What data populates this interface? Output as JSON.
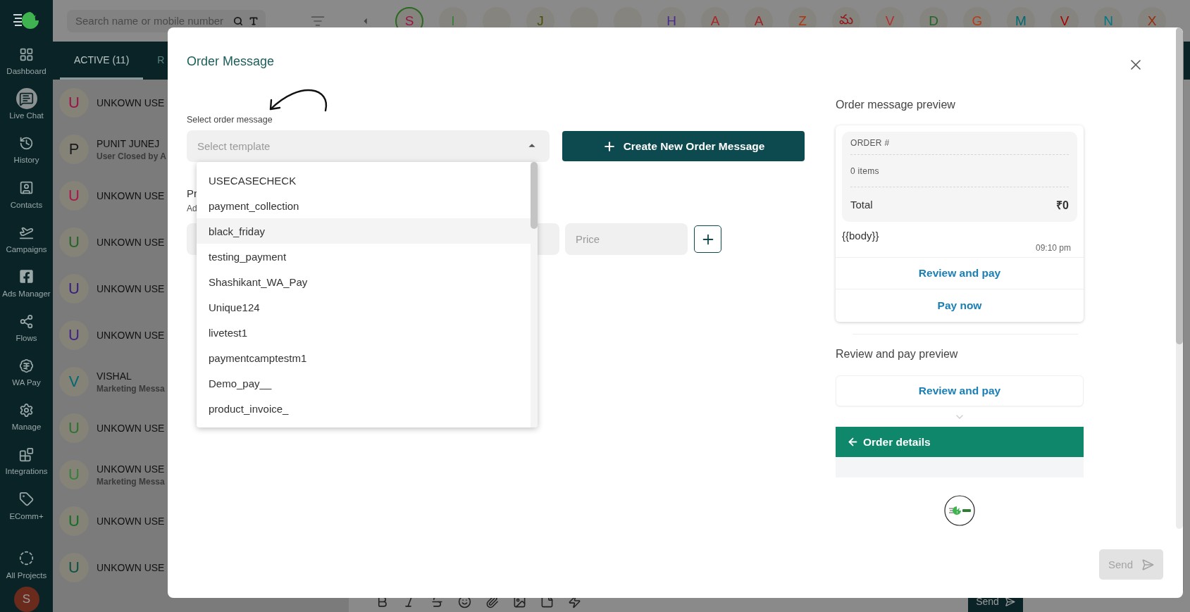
{
  "sidebar": {
    "items": [
      {
        "label": "Dashboard",
        "selected": false
      },
      {
        "label": "Live Chat",
        "selected": true
      },
      {
        "label": "History",
        "selected": false
      },
      {
        "label": "Contacts",
        "selected": false
      },
      {
        "label": "Campaigns",
        "selected": false
      },
      {
        "label": "Ads Manager",
        "selected": false
      },
      {
        "label": "Flows",
        "selected": false
      },
      {
        "label": "WA Pay",
        "selected": false
      },
      {
        "label": "Manage",
        "selected": false
      },
      {
        "label": "Integrations",
        "selected": false
      },
      {
        "label": "EComm+",
        "selected": false
      },
      {
        "label": "All Projects",
        "selected": false
      }
    ],
    "avatar": "S"
  },
  "topbar": {
    "search": {
      "placeholder": "Search name or mobile number"
    },
    "contacts": [
      {
        "kind": "letter",
        "letter": "S",
        "color": "#9b1349",
        "selected": true
      },
      {
        "kind": "letter",
        "letter": "I",
        "color": "#368039",
        "selected": false
      },
      {
        "kind": "blank",
        "selected": false
      },
      {
        "kind": "letter",
        "letter": "J",
        "color": "#4f4f0c",
        "selected": false
      },
      {
        "kind": "blank",
        "selected": false
      },
      {
        "kind": "blank",
        "selected": false
      },
      {
        "kind": "letter",
        "letter": "H",
        "color": "#4b2a8e",
        "selected": false
      },
      {
        "kind": "letter",
        "letter": "A",
        "color": "#a92626",
        "selected": false
      },
      {
        "kind": "letter",
        "letter": "A",
        "color": "#9e2020",
        "selected": false
      },
      {
        "kind": "letter",
        "letter": "Z",
        "color": "#ad3611",
        "selected": false
      },
      {
        "kind": "letter",
        "letter": "మ",
        "color": "#921616",
        "selected": false
      },
      {
        "kind": "letter",
        "letter": "V",
        "color": "#b72e2a",
        "selected": false
      },
      {
        "kind": "letter",
        "letter": "D",
        "color": "#256428",
        "selected": false
      },
      {
        "kind": "letter",
        "letter": "G",
        "color": "#b83b14",
        "selected": false
      },
      {
        "kind": "letter",
        "letter": "M",
        "color": "#006972",
        "selected": false
      },
      {
        "kind": "letter",
        "letter": "V",
        "color": "#aa0000",
        "selected": false
      },
      {
        "kind": "letter",
        "letter": "N",
        "color": "#007986",
        "selected": false
      },
      {
        "kind": "letter",
        "letter": "X",
        "color": "#992b0a",
        "selected": false
      }
    ]
  },
  "chat_list": {
    "tabs": [
      {
        "label": "ACTIVE (11)",
        "selected": true
      },
      {
        "label": "R",
        "selected": false
      }
    ],
    "chats": [
      {
        "initial": "U",
        "color": "#9b1349",
        "name": "UNKOWN USE"
      },
      {
        "initial": "P",
        "color": "#1a1a1a",
        "name": "PUNIT JUNEJ",
        "subtitle": "User Closed by A"
      },
      {
        "initial": "U",
        "color": "#ad164d",
        "name": "UNKOWN USE"
      },
      {
        "initial": "U",
        "color": "#256428",
        "name": "UNKOWN USE"
      },
      {
        "initial": "U",
        "color": "#371f80",
        "name": "UNKOWN USE"
      },
      {
        "initial": "U",
        "color": "#412486",
        "name": "UNKOWN USE"
      },
      {
        "initial": "V",
        "color": "#006972",
        "name": "VISHAL",
        "subtitle": "Marketing Messa"
      },
      {
        "initial": "U",
        "color": "#2d7230",
        "name": "UNKOWN USE"
      },
      {
        "initial": "U",
        "color": "#368039",
        "name": "UNKOWN USE",
        "subtitle": "Marketing Messa"
      },
      {
        "initial": "U",
        "color": "#166e25",
        "name": "UNKOWN USE"
      },
      {
        "initial": "U",
        "color": "#0f5049",
        "name": "UNKOWN USE"
      }
    ]
  },
  "composer": {
    "send_label": "Send"
  },
  "modal": {
    "title": "Order Message",
    "select": {
      "label": "Select order message",
      "placeholder": "Select template",
      "expanded": true
    },
    "options": [
      {
        "label": "USECASECHECK",
        "highlighted": false
      },
      {
        "label": "payment_collection",
        "highlighted": false
      },
      {
        "label": "black_friday",
        "highlighted": true
      },
      {
        "label": "testing_payment",
        "highlighted": false
      },
      {
        "label": "Shashikant_WA_Pay",
        "highlighted": false
      },
      {
        "label": "Unique124",
        "highlighted": false
      },
      {
        "label": "livetest1",
        "highlighted": false
      },
      {
        "label": "paymentcamptestm1",
        "highlighted": false
      },
      {
        "label": "Demo_pay__",
        "highlighted": false
      },
      {
        "label": "product_invoice_",
        "highlighted": false
      }
    ],
    "create_button": "Create New Order Message",
    "item_section": {
      "title_fragment": "Pr",
      "hint_fragment": "Ad"
    },
    "price": {
      "placeholder": "Price"
    },
    "preview": {
      "title": "Order message preview",
      "order_label": "ORDER #",
      "items": "0 items",
      "total_label": "Total",
      "total_value": "₹0",
      "body": "{{body}}",
      "time": "09:10 pm",
      "buttons": [
        "Review and pay",
        "Pay now"
      ]
    },
    "review_preview": {
      "title": "Review and pay preview",
      "button": "Review and pay",
      "header": "Order details"
    },
    "send": {
      "label": "Send",
      "disabled": true
    }
  }
}
